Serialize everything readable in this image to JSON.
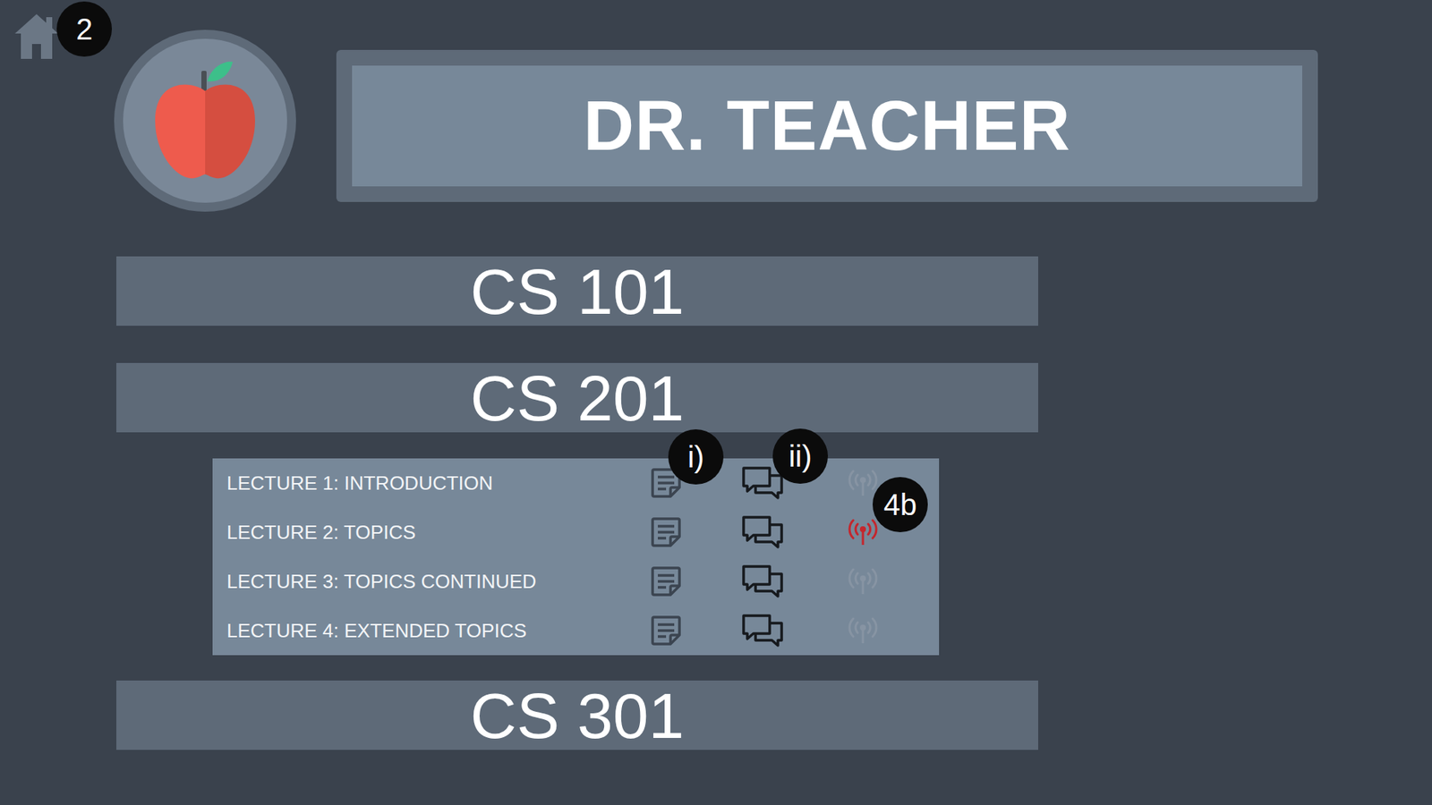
{
  "header": {
    "title": "DR. TEACHER"
  },
  "annotations": {
    "home": "2",
    "notes": "i)",
    "discussion": "ii)",
    "live": "4b"
  },
  "courses": [
    {
      "name": "CS 101",
      "expanded": false,
      "lectures": []
    },
    {
      "name": "CS 201",
      "expanded": true,
      "lectures": [
        {
          "title": "LECTURE 1: INTRODUCTION",
          "live": false
        },
        {
          "title": "LECTURE 2: TOPICS",
          "live": true
        },
        {
          "title": "LECTURE 3: TOPICS CONTINUED",
          "live": false
        },
        {
          "title": "LECTURE 4: EXTENDED TOPICS",
          "live": false
        }
      ]
    },
    {
      "name": "CS 301",
      "expanded": false,
      "lectures": []
    }
  ]
}
